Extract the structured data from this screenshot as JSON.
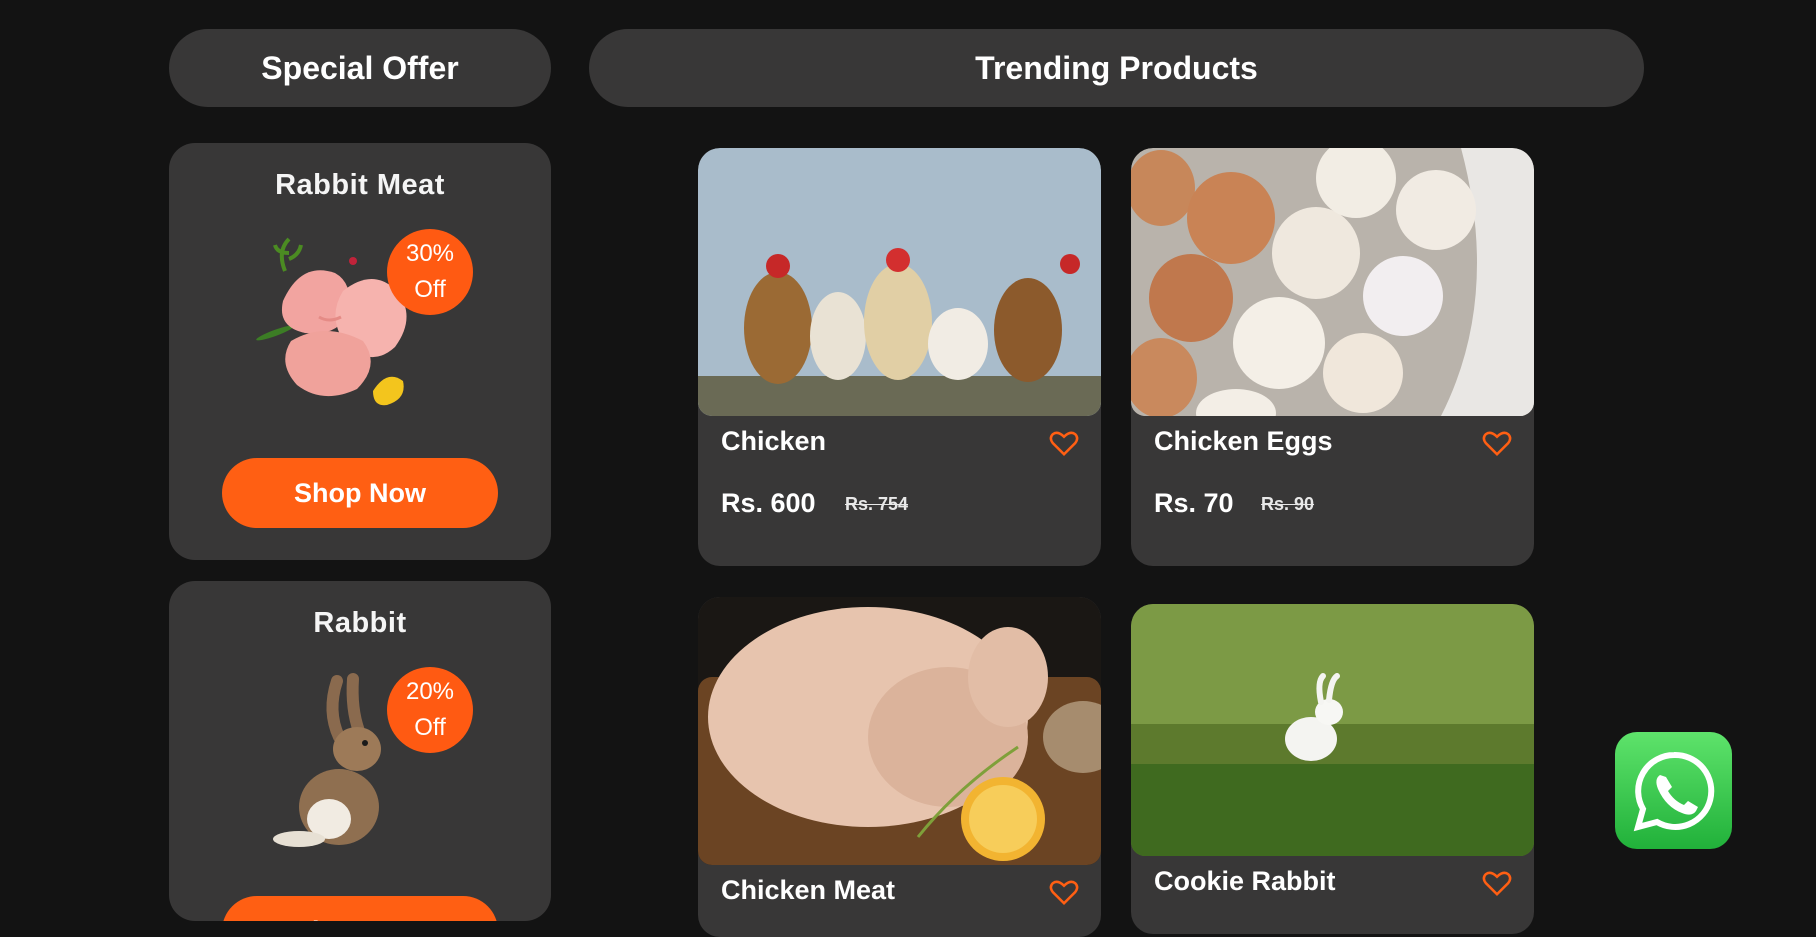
{
  "headers": {
    "special_offer": "Special Offer",
    "trending": "Trending Products"
  },
  "offers": [
    {
      "title": "Rabbit  Meat",
      "discount": "30%",
      "off": "Off",
      "button": "Shop Now"
    },
    {
      "title": "Rabbit",
      "discount": "20%",
      "off": "Off",
      "button": "Shop Now"
    }
  ],
  "products": [
    {
      "name": "Chicken",
      "price": "Rs. 600",
      "old_price": "Rs. 754"
    },
    {
      "name": "Chicken Eggs",
      "price": "Rs. 70",
      "old_price": "Rs. 90"
    },
    {
      "name": "Chicken Meat"
    },
    {
      "name": "Cookie Rabbit"
    }
  ],
  "colors": {
    "accent": "#ff5f13",
    "card": "#383737",
    "background": "#131313"
  },
  "icons": {
    "favorite": "heart-outline-icon",
    "chat": "whatsapp-icon"
  }
}
